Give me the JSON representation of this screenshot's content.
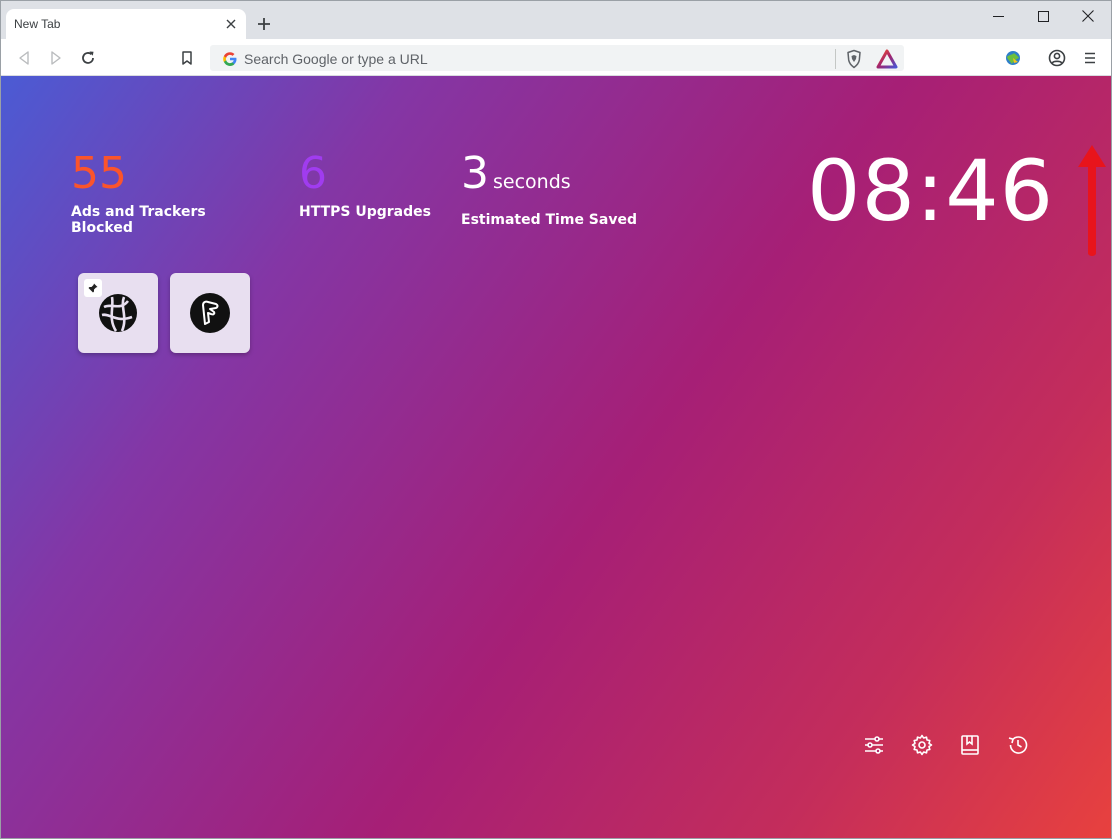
{
  "tab": {
    "title": "New Tab"
  },
  "omnibox": {
    "placeholder": "Search Google or type a URL"
  },
  "stats": {
    "ads": {
      "value": "55",
      "label": "Ads and Trackers Blocked",
      "color": "#fb542b"
    },
    "https": {
      "value": "6",
      "label": "HTTPS Upgrades",
      "color": "#a03cef"
    },
    "time": {
      "value": "3",
      "unit": "seconds",
      "label": "Estimated Time Saved"
    }
  },
  "clock": {
    "time": "08:46"
  },
  "top_sites": [
    {
      "icon": "globe-site-icon",
      "pinned": true
    },
    {
      "icon": "dark-circle-site-icon",
      "pinned": false
    }
  ],
  "ntp_actions": [
    "customize-icon",
    "settings-icon",
    "bookmarks-icon",
    "history-icon"
  ],
  "annotation": {
    "arrow_color": "#e8141c",
    "points_to": "main-menu-button"
  },
  "colors": {
    "accent_gradient_start": "#4b5bd4",
    "accent_gradient_mid": "#a61f76",
    "accent_gradient_end": "#e8413e"
  }
}
